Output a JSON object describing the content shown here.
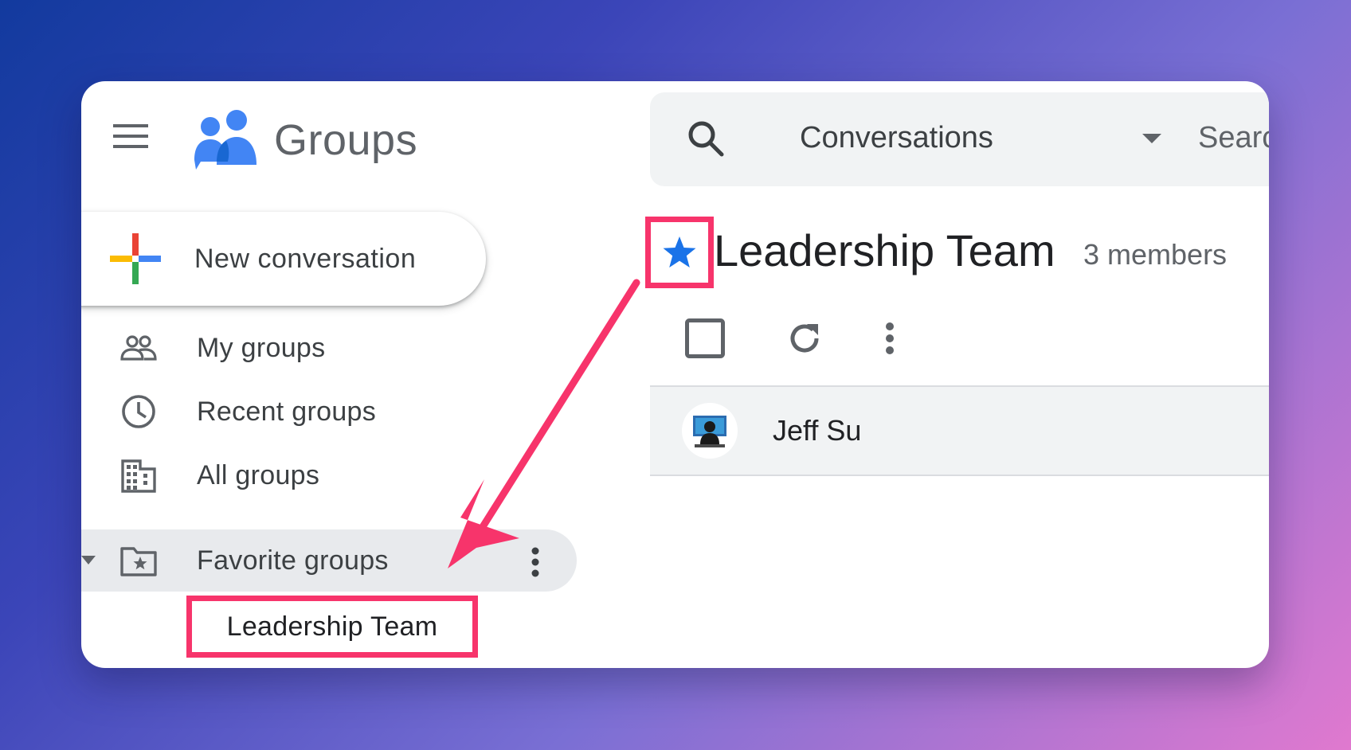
{
  "app": {
    "name": "Groups"
  },
  "sidebar": {
    "new_conversation_label": "New conversation",
    "items": [
      {
        "label": "My groups",
        "icon": "people-icon"
      },
      {
        "label": "Recent groups",
        "icon": "clock-icon"
      },
      {
        "label": "All groups",
        "icon": "building-icon"
      },
      {
        "label": "Favorite groups",
        "icon": "star-folder-icon",
        "expanded": true
      }
    ],
    "favorites": [
      {
        "label": "Leadership Team"
      }
    ]
  },
  "search": {
    "scope": "Conversations",
    "placeholder": "Search"
  },
  "group": {
    "title": "Leadership Team",
    "members": "3 members",
    "starred": true
  },
  "conversations": [
    {
      "sender": "Jeff Su"
    }
  ],
  "colors": {
    "highlight": "#f7346b",
    "star": "#1a73e8",
    "logo_blue": "#4285f4",
    "logo_dark": "#1967d2"
  }
}
